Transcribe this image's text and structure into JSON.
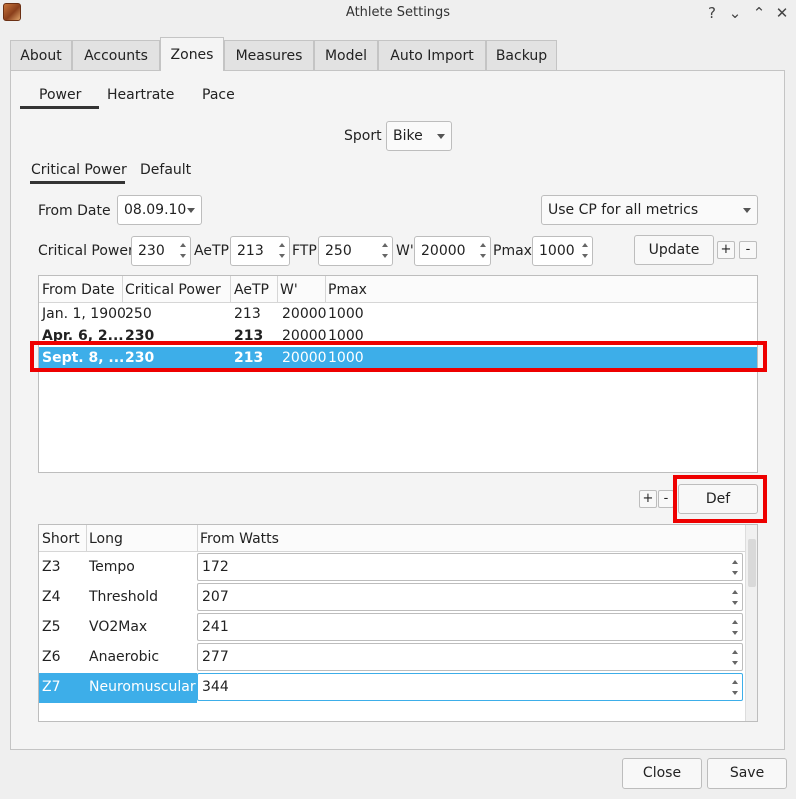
{
  "window": {
    "title": "Athlete Settings",
    "help": "?",
    "minimize": "⌄",
    "maximize": "⌃",
    "close": "✕"
  },
  "tabs": [
    "About",
    "Accounts",
    "Zones",
    "Measures",
    "Model",
    "Auto Import",
    "Backup"
  ],
  "subtabs": [
    "Power",
    "Heartrate",
    "Pace"
  ],
  "sport": {
    "label": "Sport",
    "value": "Bike"
  },
  "cp_tabs": [
    "Critical Power",
    "Default"
  ],
  "from_date": {
    "label": "From Date",
    "value": "08.09.10"
  },
  "metrics_mode": "Use CP for all metrics",
  "params": {
    "cp_label": "Critical Power",
    "cp": "230",
    "aetp_label": "AeTP",
    "aetp": "213",
    "ftp_label": "FTP",
    "ftp": "250",
    "w_label": "W'",
    "w": "20000",
    "pmax_label": "Pmax",
    "pmax": "1000"
  },
  "buttons": {
    "update": "Update",
    "add": "+",
    "remove": "-",
    "def": "Def",
    "close": "Close",
    "save": "Save"
  },
  "ranges_table": {
    "headers": [
      "From Date",
      "Critical Power",
      "AeTP",
      "W'",
      "Pmax"
    ],
    "rows": [
      [
        "Jan. 1, 1900",
        "250",
        "213",
        "20000",
        "1000"
      ],
      [
        "Apr. 6, 2...",
        "230",
        "213",
        "20000",
        "1000"
      ],
      [
        "Sept. 8, ...",
        "230",
        "213",
        "20000",
        "1000"
      ]
    ]
  },
  "zones_table": {
    "headers": [
      "Short",
      "Long",
      "From Watts"
    ],
    "rows": [
      [
        "Z3",
        "Tempo",
        "172"
      ],
      [
        "Z4",
        "Threshold",
        "207"
      ],
      [
        "Z5",
        "VO2Max",
        "241"
      ],
      [
        "Z6",
        "Anaerobic",
        "277"
      ],
      [
        "Z7",
        "Neuromuscular",
        "344"
      ]
    ]
  },
  "colors": {
    "selection": "#3daee9",
    "highlight": "#e00000"
  }
}
